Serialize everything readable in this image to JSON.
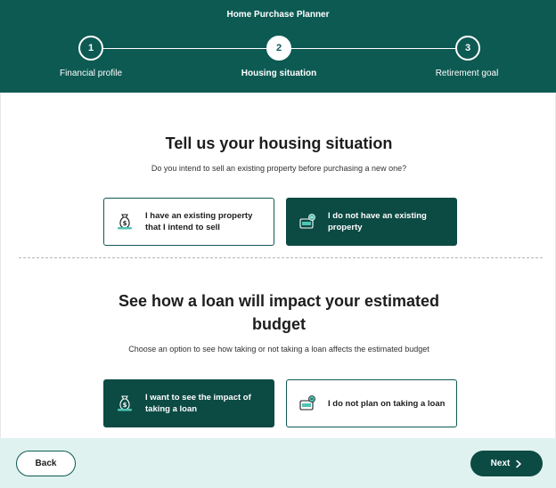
{
  "header": {
    "title": "Home Purchase Planner",
    "steps": [
      {
        "number": "1",
        "label": "Financial profile",
        "state": "complete"
      },
      {
        "number": "2",
        "label": "Housing situation",
        "state": "active"
      },
      {
        "number": "3",
        "label": "Retirement goal",
        "state": "upcoming"
      }
    ]
  },
  "housing": {
    "title": "Tell us your housing situation",
    "subtitle": "Do you intend to sell an existing property before purchasing a new one?",
    "options": [
      {
        "label": "I have an existing property that I intend to sell",
        "selected": false,
        "icon": "money-bag-icon"
      },
      {
        "label": "I do not have an existing property",
        "selected": true,
        "icon": "no-property-icon"
      }
    ]
  },
  "loan": {
    "title": "See how a loan will impact your estimated budget",
    "subtitle": "Choose an option to see how taking or not taking a loan affects the estimated budget",
    "options": [
      {
        "label": "I want to see the impact of taking a loan",
        "selected": true,
        "icon": "money-bag-icon"
      },
      {
        "label": "I do not plan on taking a loan",
        "selected": false,
        "icon": "no-loan-icon"
      }
    ]
  },
  "footer": {
    "back_label": "Back",
    "next_label": "Next",
    "next_icon": "chevron-right-icon"
  },
  "colors": {
    "primary": "#0d5a53",
    "primary_dark": "#0c4a44",
    "footer_bg": "#dff2ef",
    "accent": "#4fc3b4"
  }
}
